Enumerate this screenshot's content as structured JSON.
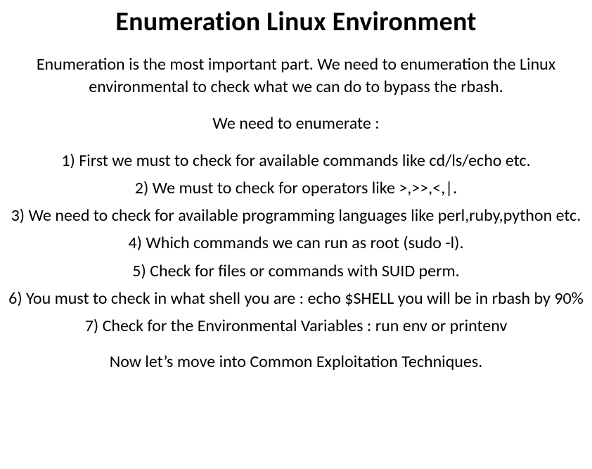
{
  "title": "Enumeration Linux Environment",
  "intro": "Enumeration is the most important part. We need to enumeration the Linux environmental to check what we can do to bypass the rbash.",
  "lead": "We need to enumerate :",
  "items": {
    "i1": "1)  First we must to check for available commands like cd/ls/echo etc.",
    "i2": "2)  We must to check for operators like >,>>,<,|.",
    "i3": "3)  We need to check for available programming languages like perl,ruby,python etc.",
    "i4": "4)  Which commands we can run as root (sudo -l).",
    "i5": "5)  Check for files or commands with SUID perm.",
    "i6": "6)  You must to check in what shell you are : echo $SHELL you will be in rbash by 90%",
    "i7": "7)  Check for the Environmental Variables : run env or printenv"
  },
  "footer": "Now let’s move into Common Exploitation Techniques."
}
